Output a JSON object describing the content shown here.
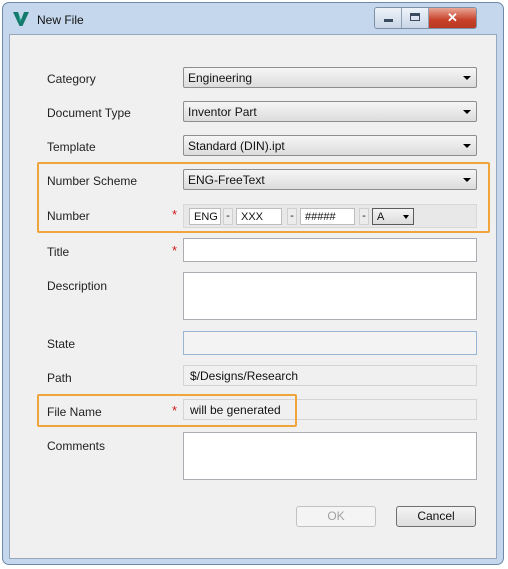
{
  "window": {
    "title": "New File",
    "icon": "vault-v-icon"
  },
  "form": {
    "category": {
      "label": "Category",
      "value": "Engineering"
    },
    "document_type": {
      "label": "Document Type",
      "value": "Inventor Part"
    },
    "template": {
      "label": "Template",
      "value": "Standard (DIN).ipt"
    },
    "number_scheme": {
      "label": "Number Scheme",
      "value": "ENG-FreeText"
    },
    "number": {
      "label": "Number",
      "required": "*",
      "segments": [
        "ENG",
        "-",
        "XXX",
        "-",
        "#####",
        "-"
      ],
      "suffix_value": "A"
    },
    "title": {
      "label": "Title",
      "required": "*",
      "value": ""
    },
    "description": {
      "label": "Description",
      "value": ""
    },
    "state": {
      "label": "State",
      "value": ""
    },
    "path": {
      "label": "Path",
      "value": "$/Designs/Research"
    },
    "file_name": {
      "label": "File Name",
      "required": "*",
      "value": "will be generated"
    },
    "comments": {
      "label": "Comments",
      "value": ""
    }
  },
  "buttons": {
    "ok": "OK",
    "cancel": "Cancel"
  },
  "colors": {
    "highlight": "#f0a43c",
    "required": "#d21818",
    "frame": "#c4d7ec"
  }
}
